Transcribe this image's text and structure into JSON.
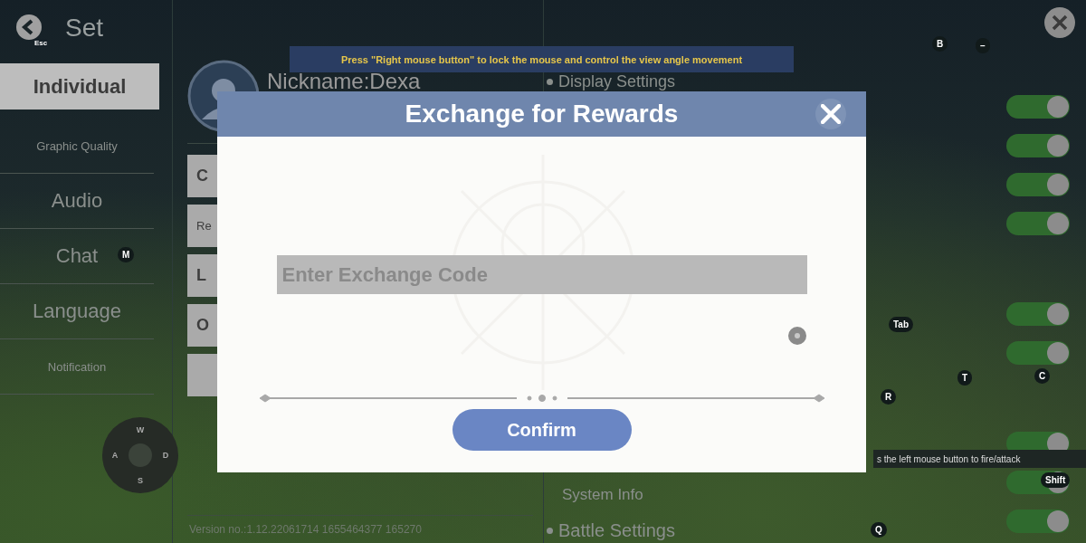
{
  "header": {
    "back_key": "Esc",
    "title": "Set"
  },
  "sidebar": {
    "items": [
      {
        "label": "Individual",
        "kind": "large",
        "selected": true
      },
      {
        "label": "Graphic Quality",
        "kind": "small",
        "selected": false
      },
      {
        "label": "Audio",
        "kind": "large",
        "selected": false
      },
      {
        "label": "Chat",
        "kind": "large",
        "selected": false
      },
      {
        "label": "Language",
        "kind": "large",
        "selected": false
      },
      {
        "label": "Notification",
        "kind": "small",
        "selected": false
      }
    ]
  },
  "profile": {
    "nickname": "Nickname:Dexa",
    "buttons": [
      {
        "kind": "text",
        "label": "C"
      },
      {
        "kind": "text",
        "label": "Re"
      },
      {
        "kind": "text",
        "label": "L"
      },
      {
        "kind": "text",
        "label": "O"
      },
      {
        "kind": "blank"
      }
    ],
    "version": "Version no.:1.12.22061714 1655464377 165270"
  },
  "settings": {
    "sections": [
      {
        "label": "Display Settings",
        "kind": "heading"
      },
      {
        "label": "System Info",
        "kind": "sub"
      },
      {
        "label": "Battle Settings",
        "kind": "heading"
      }
    ],
    "toggles": [
      {
        "on": true
      },
      {
        "on": true
      },
      {
        "on": true
      },
      {
        "on": true
      },
      {
        "on": true
      },
      {
        "on": true
      },
      {
        "on": true
      },
      {
        "on": true
      },
      {
        "on": true
      }
    ]
  },
  "hint_banner": "Press \"Right mouse button\" to lock the mouse and control the view angle movement",
  "fire_hint": "s the left mouse button to fire/attack",
  "key_hints": [
    "B",
    "–",
    "M",
    "Tab",
    "T",
    "C",
    "R",
    "Shift",
    "Q"
  ],
  "joystick": [
    "W",
    "A",
    "S",
    "D"
  ],
  "dialog": {
    "title": "Exchange for Rewards",
    "placeholder": "Enter Exchange Code",
    "confirm": "Confirm"
  }
}
